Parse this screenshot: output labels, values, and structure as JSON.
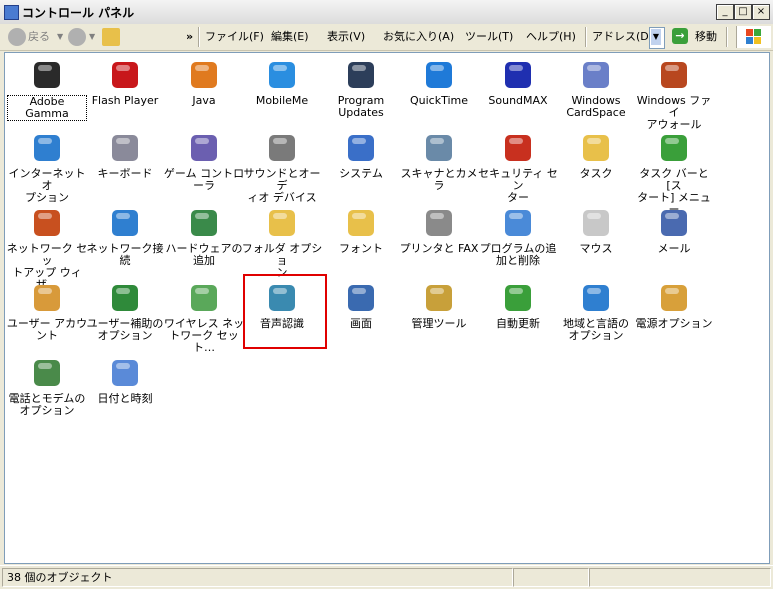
{
  "window": {
    "title": "コントロール パネル"
  },
  "toolbar": {
    "back_label": "戻る",
    "chevron": "»",
    "menus": [
      "ファイル(F)",
      "編集(E)",
      "表示(V)",
      "お気に入り(A)",
      "ツール(T)",
      "ヘルプ(H)"
    ],
    "address_label": "アドレス(D)",
    "go_label": "移動"
  },
  "items": [
    {
      "label": "Adobe Gamma",
      "icon": "monitor-icon",
      "color": "#2a2a2a",
      "selected": true
    },
    {
      "label": "Flash Player",
      "icon": "flash-icon",
      "color": "#c8171b"
    },
    {
      "label": "Java",
      "icon": "java-icon",
      "color": "#e07a1f"
    },
    {
      "label": "MobileMe",
      "icon": "cloud-icon",
      "color": "#2a8ee0"
    },
    {
      "label": "Program\nUpdates",
      "icon": "program-updates-icon",
      "color": "#2c3e5a"
    },
    {
      "label": "QuickTime",
      "icon": "quicktime-icon",
      "color": "#1f7ad8"
    },
    {
      "label": "SoundMAX",
      "icon": "soundmax-icon",
      "color": "#1f2fb0"
    },
    {
      "label": "Windows\nCardSpace",
      "icon": "cardspace-icon",
      "color": "#6a7fc8"
    },
    {
      "label": "Windows ファイ\nアウォール",
      "icon": "firewall-icon",
      "color": "#b8471f"
    },
    {
      "label": "インターネット オ\nプション",
      "icon": "internet-options-icon",
      "color": "#2f7fd0"
    },
    {
      "label": "キーボード",
      "icon": "keyboard-icon",
      "color": "#8a8a9a"
    },
    {
      "label": "ゲーム コントロ\nーラ",
      "icon": "gamepad-icon",
      "color": "#6b5fb0"
    },
    {
      "label": "サウンドとオーデ\nィオ デバイス",
      "icon": "speaker-icon",
      "color": "#7a7a7a"
    },
    {
      "label": "システム",
      "icon": "system-icon",
      "color": "#3a6fc8"
    },
    {
      "label": "スキャナとカメラ",
      "icon": "scanner-icon",
      "color": "#6a8aa8"
    },
    {
      "label": "セキュリティ セン\nター",
      "icon": "shield-icon",
      "color": "#c8301f"
    },
    {
      "label": "タスク",
      "icon": "tasks-folder-icon",
      "color": "#e8c04a"
    },
    {
      "label": "タスク バーと [ス\nタート] メニュー",
      "icon": "taskbar-icon",
      "color": "#3a9f3a"
    },
    {
      "label": "ネットワーク セッ\nトアップ ウィザ…",
      "icon": "network-setup-icon",
      "color": "#c8501f"
    },
    {
      "label": "ネットワーク接\n続",
      "icon": "network-connections-icon",
      "color": "#2f7fd0"
    },
    {
      "label": "ハードウェアの\n追加",
      "icon": "hardware-icon",
      "color": "#3a8a4a"
    },
    {
      "label": "フォルダ オプショ\nン",
      "icon": "folder-options-icon",
      "color": "#e8c04a"
    },
    {
      "label": "フォント",
      "icon": "fonts-folder-icon",
      "color": "#e8c04a"
    },
    {
      "label": "プリンタと FAX",
      "icon": "printer-icon",
      "color": "#8a8a8a"
    },
    {
      "label": "プログラムの追\n加と削除",
      "icon": "add-remove-programs-icon",
      "color": "#4a8ad8"
    },
    {
      "label": "マウス",
      "icon": "mouse-icon",
      "color": "#c8c8c8"
    },
    {
      "label": "メール",
      "icon": "mail-icon",
      "color": "#4a6ab0"
    },
    {
      "label": "ユーザー アカウ\nント",
      "icon": "users-icon",
      "color": "#d89a3a"
    },
    {
      "label": "ユーザー補助の\nオプション",
      "icon": "accessibility-icon",
      "color": "#2f8a3a"
    },
    {
      "label": "ワイヤレス ネッ\nトワーク セット…",
      "icon": "wireless-icon",
      "color": "#5aa85a"
    },
    {
      "label": "音声認識",
      "icon": "speech-icon",
      "color": "#3a8ab0",
      "highlighted": true
    },
    {
      "label": "画面",
      "icon": "display-icon",
      "color": "#3a6ab0"
    },
    {
      "label": "管理ツール",
      "icon": "admin-tools-icon",
      "color": "#c8a03a"
    },
    {
      "label": "自動更新",
      "icon": "windows-update-icon",
      "color": "#3a9f3a"
    },
    {
      "label": "地域と言語の\nオプション",
      "icon": "globe-icon",
      "color": "#2f7fd0"
    },
    {
      "label": "電源オプション",
      "icon": "power-icon",
      "color": "#d8a03a"
    },
    {
      "label": "電話とモデムの\nオプション",
      "icon": "phone-modem-icon",
      "color": "#4a8a4a"
    },
    {
      "label": "日付と時刻",
      "icon": "clock-icon",
      "color": "#5a8ad8"
    }
  ],
  "status": {
    "count": "38 個のオブジェクト"
  }
}
